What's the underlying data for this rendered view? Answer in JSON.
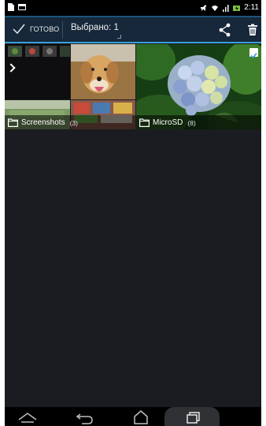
{
  "status_bar": {
    "time": "2:11",
    "left_icons": [
      "document-icon",
      "image-icon"
    ],
    "right_icons": [
      "mute-icon",
      "wifi-icon",
      "signal-icon",
      "battery-charging-icon"
    ]
  },
  "action_bar": {
    "done_label": "ГОТОВО",
    "selected_label": "Выбрано: 1",
    "share_icon": "share-icon",
    "delete_icon": "trash-icon"
  },
  "albums": [
    {
      "name": "Screenshots",
      "count": "(3)",
      "icon": "folder-icon",
      "selected": false
    },
    {
      "name": "MicroSD",
      "count": "(8)",
      "icon": "folder-icon",
      "selected": true
    }
  ],
  "nav_bar": {
    "buttons": [
      "app-switch-icon",
      "back-icon",
      "home-icon",
      "recent-apps-icon"
    ]
  },
  "colors": {
    "screen_bg": "#1b1c21",
    "action_bar_bg": "#16283a",
    "accent": "#3aa0d8",
    "nav_bg": "#000000"
  }
}
